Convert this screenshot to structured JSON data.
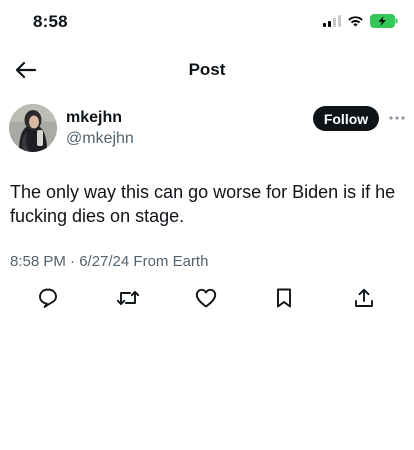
{
  "status_bar": {
    "time": "8:58",
    "icons": [
      "cellular-signal-icon",
      "wifi-icon",
      "battery-charging-icon"
    ],
    "battery_color": "#34c759"
  },
  "header": {
    "title": "Post",
    "back_icon": "arrow-left-icon"
  },
  "author": {
    "display_name": "mkejhn",
    "handle": "@mkejhn",
    "follow_label": "Follow",
    "more_icon": "more-horizontal-icon"
  },
  "tweet": {
    "text": "The only way this can go worse for Biden is if he fucking dies on stage.",
    "meta": "8:58 PM · 6/27/24 From Earth"
  },
  "actions": [
    {
      "name": "reply",
      "icon": "reply-bubble-icon"
    },
    {
      "name": "repost",
      "icon": "repost-icon"
    },
    {
      "name": "like",
      "icon": "heart-icon"
    },
    {
      "name": "bookmark",
      "icon": "bookmark-icon"
    },
    {
      "name": "share",
      "icon": "share-icon"
    }
  ],
  "colors": {
    "text_primary": "#0f1419",
    "text_secondary": "#536471",
    "follow_bg": "#0f1419"
  }
}
